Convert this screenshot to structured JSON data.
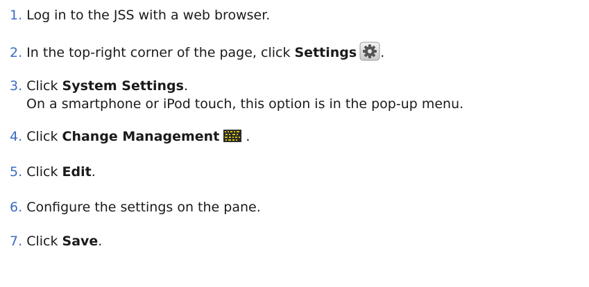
{
  "steps": [
    {
      "number": "1.",
      "parts": [
        "Log in to the JSS with a web browser."
      ]
    },
    {
      "number": "2.",
      "pre": "In the top-right corner of the page, click ",
      "bold": "Settings",
      "post": "."
    },
    {
      "number": "3.",
      "pre": "Click ",
      "bold": "System Settings",
      "post": ".",
      "note": "On a smartphone or iPod touch, this option is in the pop-up menu."
    },
    {
      "number": "4.",
      "pre": "Click ",
      "bold": "Change Management",
      "post": "."
    },
    {
      "number": "5.",
      "pre": "Click ",
      "bold": "Edit",
      "post": "."
    },
    {
      "number": "6.",
      "parts": [
        "Configure the settings on the pane."
      ]
    },
    {
      "number": "7.",
      "pre": "Click ",
      "bold": "Save",
      "post": "."
    }
  ],
  "icons": {
    "settings": "gear-icon",
    "change_management": "change-management-icon"
  }
}
